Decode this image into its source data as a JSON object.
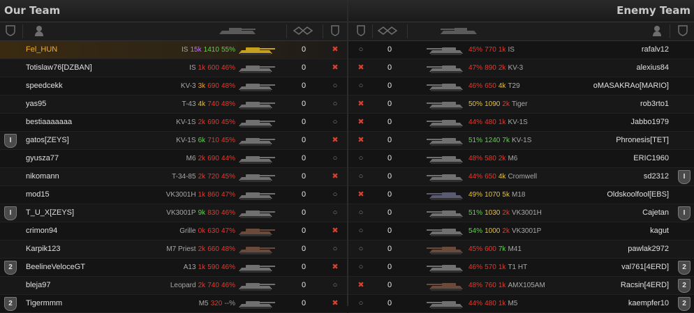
{
  "teams": {
    "ours": "Our Team",
    "enemy": "Enemy Team"
  },
  "ours": [
    {
      "name": "Fel_HUN",
      "tank": "IS",
      "battles": "15k",
      "bcls": "purple",
      "wn": "1410",
      "wcls": "green",
      "win": "55%",
      "pct": "green",
      "frags": "0",
      "status": "dead",
      "badge": "",
      "self": true,
      "tcolor": "#c8a020"
    },
    {
      "name": "Totislaw76[DZBAN]",
      "tank": "IS",
      "battles": "1k",
      "bcls": "red",
      "wn": "600",
      "wcls": "red",
      "win": "46%",
      "pct": "red",
      "frags": "0",
      "status": "dead",
      "badge": "",
      "tcolor": "#707070"
    },
    {
      "name": "speedcekk",
      "tank": "KV-3",
      "battles": "3k",
      "bcls": "orange",
      "wn": "690",
      "wcls": "red",
      "win": "48%",
      "pct": "red",
      "frags": "0",
      "status": "alive",
      "badge": "",
      "tcolor": "#707070"
    },
    {
      "name": "yas95",
      "tank": "T-43",
      "battles": "4k",
      "bcls": "yellow",
      "wn": "740",
      "wcls": "red",
      "win": "48%",
      "pct": "red",
      "frags": "0",
      "status": "alive",
      "badge": "",
      "tcolor": "#707070"
    },
    {
      "name": "bestiaaaaaaa",
      "tank": "KV-1S",
      "battles": "2k",
      "bcls": "red",
      "wn": "690",
      "wcls": "red",
      "win": "45%",
      "pct": "red",
      "frags": "0",
      "status": "alive",
      "badge": "",
      "tcolor": "#707070"
    },
    {
      "name": "gatos[ZEYS]",
      "tank": "KV-1S",
      "battles": "6k",
      "bcls": "green",
      "wn": "710",
      "wcls": "red",
      "win": "45%",
      "pct": "red",
      "frags": "0",
      "status": "dead",
      "badge": "I",
      "tcolor": "#707070"
    },
    {
      "name": "gyusza77",
      "tank": "M6",
      "battles": "2k",
      "bcls": "red",
      "wn": "690",
      "wcls": "red",
      "win": "44%",
      "pct": "red",
      "frags": "0",
      "status": "alive",
      "badge": "",
      "tcolor": "#707070"
    },
    {
      "name": "nikomann",
      "tank": "T-34-85",
      "battles": "2k",
      "bcls": "red",
      "wn": "720",
      "wcls": "red",
      "win": "45%",
      "pct": "red",
      "frags": "0",
      "status": "dead",
      "badge": "",
      "tcolor": "#707070"
    },
    {
      "name": "mod15",
      "tank": "VK3001H",
      "battles": "1k",
      "bcls": "red",
      "wn": "860",
      "wcls": "red",
      "win": "47%",
      "pct": "red",
      "frags": "0",
      "status": "alive",
      "badge": "",
      "tcolor": "#707070"
    },
    {
      "name": "T_U_X[ZEYS]",
      "tank": "VK3001P",
      "battles": "9k",
      "bcls": "green",
      "wn": "830",
      "wcls": "red",
      "win": "46%",
      "pct": "red",
      "frags": "0",
      "status": "alive",
      "badge": "I",
      "tcolor": "#707070"
    },
    {
      "name": "crimon94",
      "tank": "Grille",
      "battles": "0k",
      "bcls": "red",
      "wn": "630",
      "wcls": "red",
      "win": "47%",
      "pct": "red",
      "frags": "0",
      "status": "dead",
      "badge": "",
      "tcolor": "#6a4a3a"
    },
    {
      "name": "Karpik123",
      "tank": "M7 Priest",
      "battles": "2k",
      "bcls": "red",
      "wn": "660",
      "wcls": "red",
      "win": "48%",
      "pct": "red",
      "frags": "0",
      "status": "alive",
      "badge": "",
      "tcolor": "#6a4a3a"
    },
    {
      "name": "BeelineVeloceGT",
      "tank": "A13",
      "battles": "1k",
      "bcls": "red",
      "wn": "590",
      "wcls": "red",
      "win": "46%",
      "pct": "red",
      "frags": "0",
      "status": "dead",
      "badge": "2",
      "tcolor": "#707070"
    },
    {
      "name": "bleja97",
      "tank": "Leopard",
      "battles": "2k",
      "bcls": "red",
      "wn": "740",
      "wcls": "red",
      "win": "46%",
      "pct": "red",
      "frags": "0",
      "status": "alive",
      "badge": "",
      "tcolor": "#707070"
    },
    {
      "name": "Tigermmm",
      "tank": "M5",
      "battles": "",
      "bcls": "red",
      "wn": "320",
      "wcls": "red",
      "win": "--%",
      "pct": "grey",
      "frags": "0",
      "status": "dead",
      "badge": "2",
      "tcolor": "#707070"
    }
  ],
  "enemy": [
    {
      "name": "rafalv12",
      "tank": "IS",
      "battles": "1k",
      "bcls": "red",
      "wn": "770",
      "wcls": "red",
      "win": "45%",
      "pct": "red",
      "frags": "0",
      "status": "alive",
      "badge": "",
      "tcolor": "#707070"
    },
    {
      "name": "alexius84",
      "tank": "KV-3",
      "battles": "2k",
      "bcls": "red",
      "wn": "890",
      "wcls": "red",
      "win": "47%",
      "pct": "red",
      "frags": "0",
      "status": "dead",
      "badge": "",
      "tcolor": "#707070"
    },
    {
      "name": "oMASAKRAo[MARIO]",
      "tank": "T29",
      "battles": "4k",
      "bcls": "yellow",
      "wn": "650",
      "wcls": "red",
      "win": "46%",
      "pct": "red",
      "frags": "0",
      "status": "alive",
      "badge": "",
      "tcolor": "#707070"
    },
    {
      "name": "rob3rto1",
      "tank": "Tiger",
      "battles": "2k",
      "bcls": "red",
      "wn": "1090",
      "wcls": "yellow",
      "win": "50%",
      "pct": "yellow",
      "frags": "0",
      "status": "dead",
      "badge": "",
      "tcolor": "#707070"
    },
    {
      "name": "Jabbo1979",
      "tank": "KV-1S",
      "battles": "1k",
      "bcls": "red",
      "wn": "480",
      "wcls": "red",
      "win": "44%",
      "pct": "red",
      "frags": "0",
      "status": "dead",
      "badge": "",
      "tcolor": "#707070"
    },
    {
      "name": "Phronesis[TET]",
      "tank": "KV-1S",
      "battles": "7k",
      "bcls": "green",
      "wn": "1240",
      "wcls": "green",
      "win": "51%",
      "pct": "green",
      "frags": "0",
      "status": "dead",
      "badge": "",
      "tcolor": "#707070"
    },
    {
      "name": "ERIC1960",
      "tank": "M6",
      "battles": "2k",
      "bcls": "red",
      "wn": "580",
      "wcls": "red",
      "win": "48%",
      "pct": "red",
      "frags": "0",
      "status": "alive",
      "badge": "",
      "tcolor": "#707070"
    },
    {
      "name": "sd2312",
      "tank": "Cromwell",
      "battles": "4k",
      "bcls": "yellow",
      "wn": "650",
      "wcls": "red",
      "win": "44%",
      "pct": "red",
      "frags": "0",
      "status": "alive",
      "badge": "I",
      "tcolor": "#707070"
    },
    {
      "name": "Oldskoolfool[EBS]",
      "tank": "M18",
      "battles": "5k",
      "bcls": "yellow",
      "wn": "1070",
      "wcls": "yellow",
      "win": "49%",
      "pct": "yellow",
      "frags": "0",
      "status": "dead",
      "badge": "",
      "tcolor": "#5a5a70"
    },
    {
      "name": "Cajetan",
      "tank": "VK3001H",
      "battles": "2k",
      "bcls": "red",
      "wn": "1030",
      "wcls": "yellow",
      "win": "51%",
      "pct": "green",
      "frags": "0",
      "status": "alive",
      "badge": "I",
      "tcolor": "#707070"
    },
    {
      "name": "kagut",
      "tank": "VK3001P",
      "battles": "2k",
      "bcls": "red",
      "wn": "1000",
      "wcls": "yellow",
      "win": "54%",
      "pct": "green",
      "frags": "0",
      "status": "alive",
      "badge": "",
      "tcolor": "#707070"
    },
    {
      "name": "pawlak2972",
      "tank": "M41",
      "battles": "7k",
      "bcls": "green",
      "wn": "600",
      "wcls": "red",
      "win": "45%",
      "pct": "red",
      "frags": "0",
      "status": "alive",
      "badge": "",
      "tcolor": "#6a4a3a"
    },
    {
      "name": "val761[4ERD]",
      "tank": "T1 HT",
      "battles": "1k",
      "bcls": "red",
      "wn": "570",
      "wcls": "red",
      "win": "46%",
      "pct": "red",
      "frags": "0",
      "status": "alive",
      "badge": "2",
      "tcolor": "#707070"
    },
    {
      "name": "Racsin[4ERD]",
      "tank": "AMX105AM",
      "battles": "1k",
      "bcls": "red",
      "wn": "760",
      "wcls": "red",
      "win": "48%",
      "pct": "red",
      "frags": "0",
      "status": "dead",
      "badge": "2",
      "tcolor": "#6a4a3a"
    },
    {
      "name": "kaempfer10",
      "tank": "M5",
      "battles": "1k",
      "bcls": "red",
      "wn": "480",
      "wcls": "red",
      "win": "44%",
      "pct": "red",
      "frags": "0",
      "status": "alive",
      "badge": "2",
      "tcolor": "#707070"
    }
  ],
  "icons": {
    "dead": "✖",
    "alive": "○",
    "platoon": "shield-icon",
    "player": "person-icon",
    "tank": "tank-icon",
    "frags": "frags-icon",
    "vehicle_status": "status-icon"
  }
}
